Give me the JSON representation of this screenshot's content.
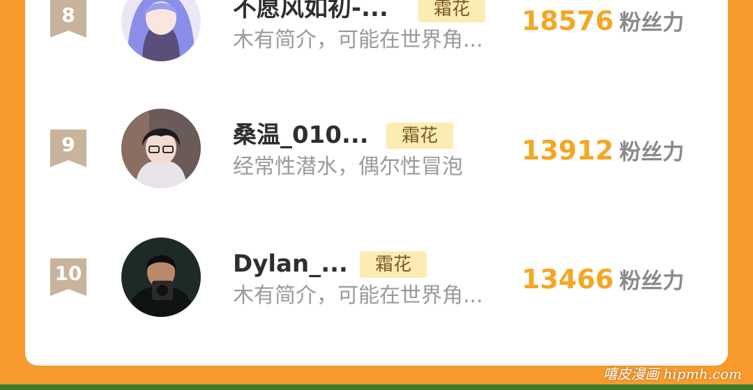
{
  "ranking": {
    "entries": [
      {
        "rank": "8",
        "name": "不愿风如初-...",
        "tag": "霜花",
        "bio": "木有简介，可能在世界角...",
        "fans_value": "18576",
        "fans_label": "粉丝力"
      },
      {
        "rank": "9",
        "name": "桑温_010...",
        "tag": "霜花",
        "bio": "经常性潜水，偶尔性冒泡",
        "fans_value": "13912",
        "fans_label": "粉丝力"
      },
      {
        "rank": "10",
        "name": "Dylan_...",
        "tag": "霜花",
        "bio": "木有简介，可能在世界角...",
        "fans_value": "13466",
        "fans_label": "粉丝力"
      }
    ]
  },
  "watermark": "嘻皮漫画 hipmh.com",
  "colors": {
    "background": "#f89a2c",
    "card": "#ffffff",
    "rank_badge": "#c9b39a",
    "tag_bg": "#fcebb2",
    "fans_value": "#f5a623",
    "name": "#2e2e2e",
    "bio": "#9a9a9a"
  }
}
